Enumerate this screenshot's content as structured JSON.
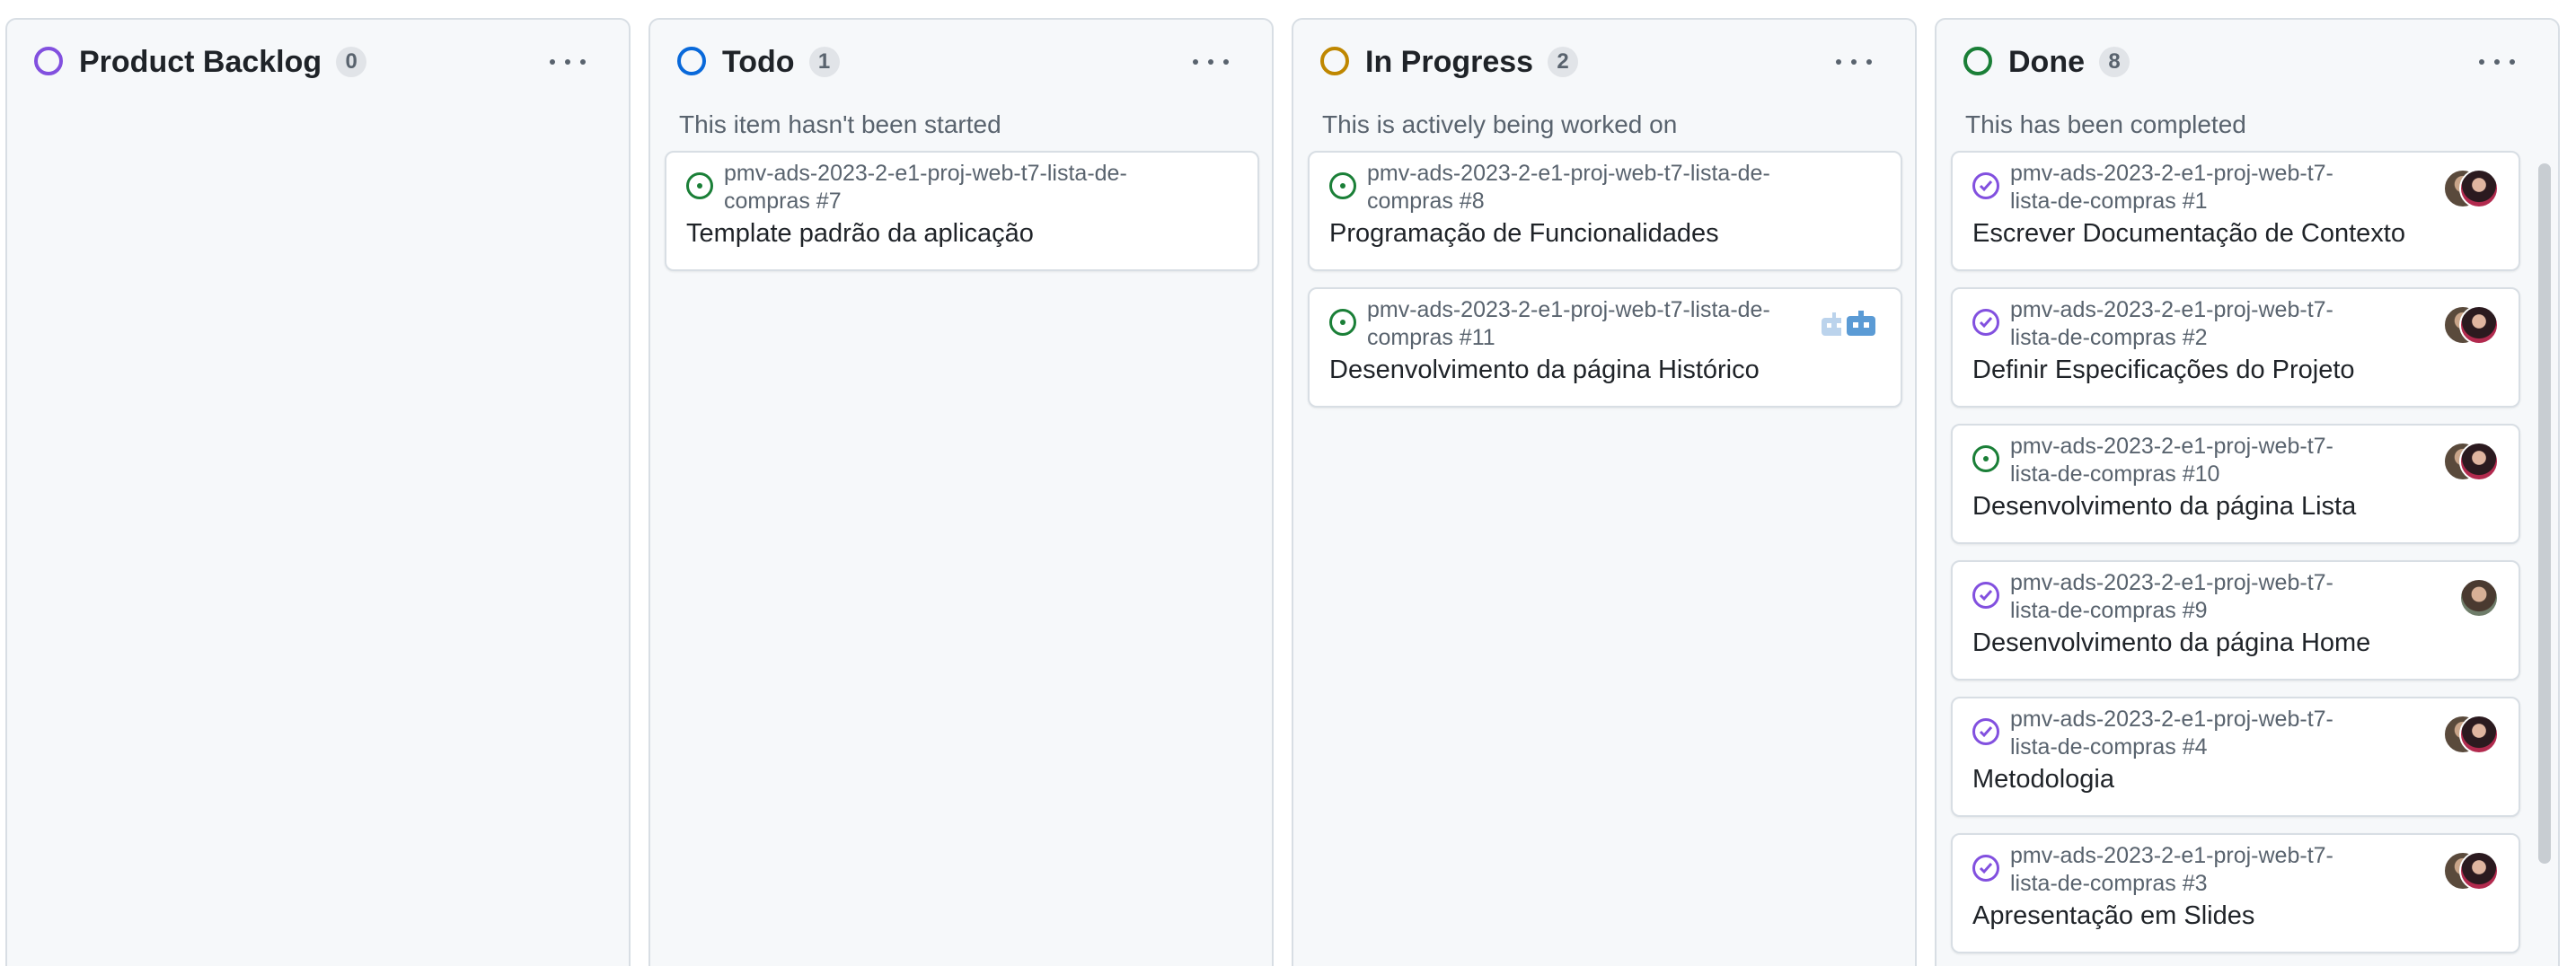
{
  "colors": {
    "backlog_ring": "#8250df",
    "todo_ring": "#0969da",
    "progress_ring": "#bf8700",
    "done_ring": "#1a7f37",
    "open_issue": "#1a7f37",
    "closed_issue": "#8250df"
  },
  "columns": [
    {
      "title": "Product Backlog",
      "count": "0",
      "description": "",
      "cards": []
    },
    {
      "title": "Todo",
      "count": "1",
      "description": "This item hasn't been started",
      "cards": [
        {
          "repo": "pmv-ads-2023-2-e1-proj-web-t7-lista-de-compras #7",
          "title": "Template padrão da aplicação",
          "state": "open",
          "assignees": []
        }
      ]
    },
    {
      "title": "In Progress",
      "count": "2",
      "description": "This is actively being worked on",
      "cards": [
        {
          "repo": "pmv-ads-2023-2-e1-proj-web-t7-lista-de-compras #8",
          "title": "Programação de Funcionalidades",
          "state": "open",
          "assignees": []
        },
        {
          "repo": "pmv-ads-2023-2-e1-proj-web-t7-lista-de-compras #11",
          "title": "Desenvolvimento da página Histórico",
          "state": "open",
          "assignees": [
            "bot-avatar",
            "bot-avatar"
          ]
        }
      ]
    },
    {
      "title": "Done",
      "count": "8",
      "description": "This has been completed",
      "cards": [
        {
          "repo": "pmv-ads-2023-2-e1-proj-web-t7-lista-de-compras #1",
          "title": "Escrever Documentação de Contexto",
          "state": "closed",
          "assignees": [
            "avatar",
            "avatar"
          ]
        },
        {
          "repo": "pmv-ads-2023-2-e1-proj-web-t7-lista-de-compras #2",
          "title": "Definir Especificações do Projeto",
          "state": "closed",
          "assignees": [
            "avatar",
            "avatar"
          ]
        },
        {
          "repo": "pmv-ads-2023-2-e1-proj-web-t7-lista-de-compras #10",
          "title": "Desenvolvimento da página Lista",
          "state": "open",
          "assignees": [
            "avatar",
            "avatar"
          ]
        },
        {
          "repo": "pmv-ads-2023-2-e1-proj-web-t7-lista-de-compras #9",
          "title": "Desenvolvimento da página Home",
          "state": "closed",
          "assignees": [
            "avatar"
          ]
        },
        {
          "repo": "pmv-ads-2023-2-e1-proj-web-t7-lista-de-compras #4",
          "title": "Metodologia",
          "state": "closed",
          "assignees": [
            "avatar",
            "avatar"
          ]
        },
        {
          "repo": "pmv-ads-2023-2-e1-proj-web-t7-lista-de-compras #3",
          "title": "Apresentação em Slides",
          "state": "closed",
          "assignees": [
            "avatar",
            "avatar"
          ]
        }
      ]
    }
  ]
}
